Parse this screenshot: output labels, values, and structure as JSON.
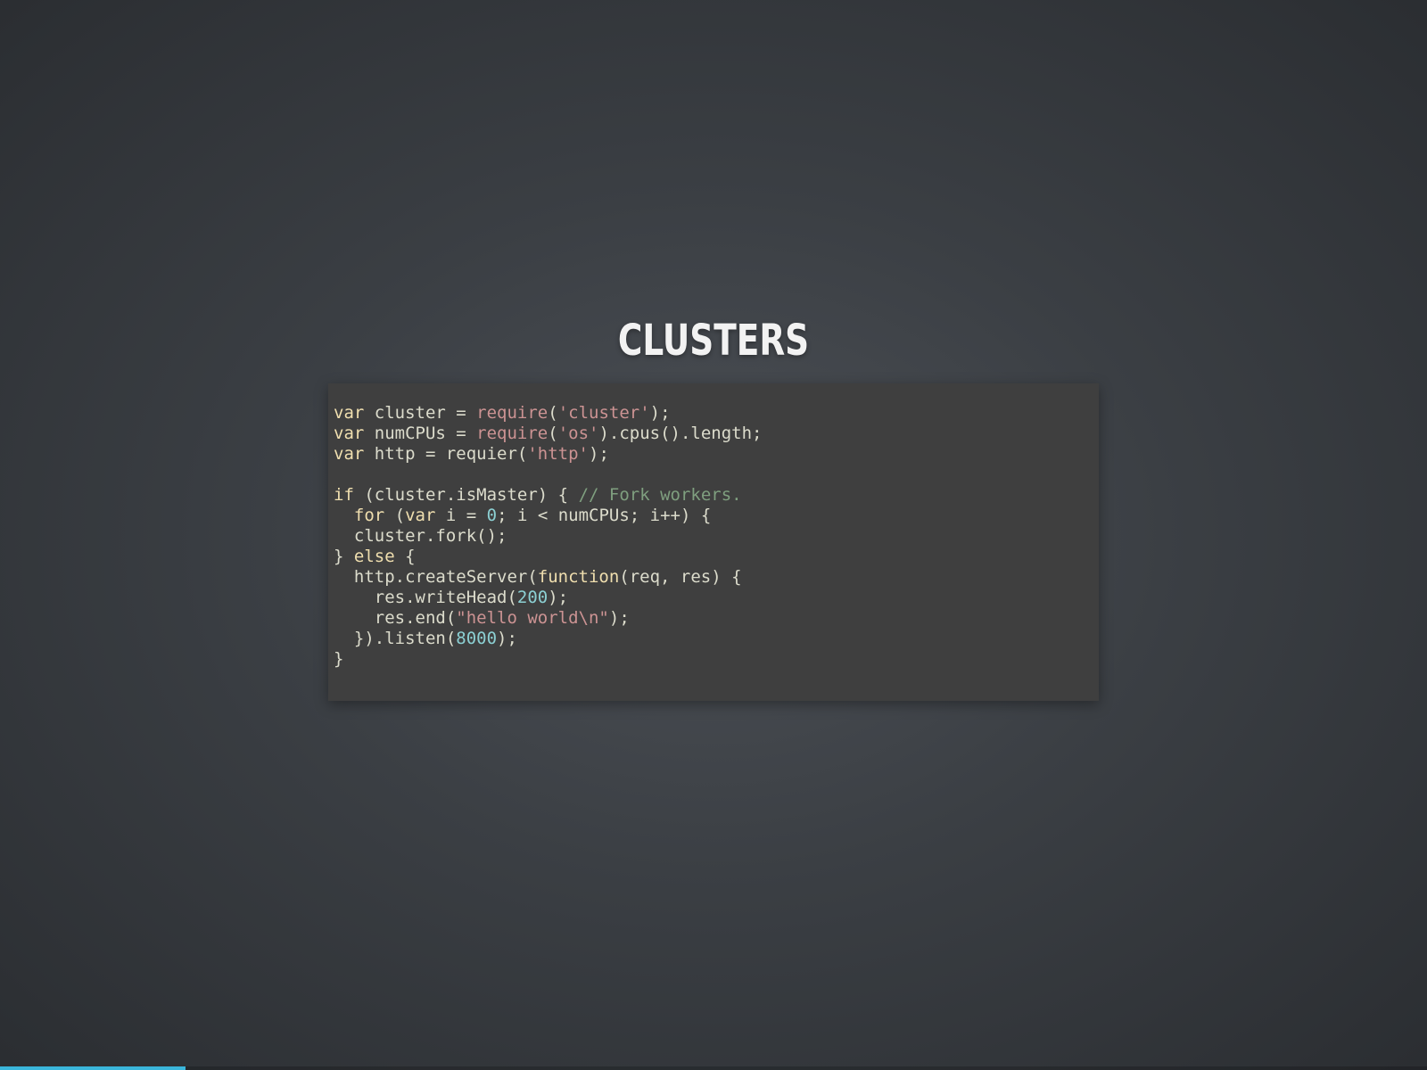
{
  "slide": {
    "title": "CLUSTERS"
  },
  "code": {
    "language": "javascript",
    "lines": [
      [
        {
          "t": "kw",
          "v": "var"
        },
        {
          "t": "pl",
          "v": " cluster = "
        },
        {
          "t": "fn",
          "v": "require"
        },
        {
          "t": "pl",
          "v": "("
        },
        {
          "t": "str",
          "v": "'cluster'"
        },
        {
          "t": "pl",
          "v": ");"
        }
      ],
      [
        {
          "t": "kw",
          "v": "var"
        },
        {
          "t": "pl",
          "v": " numCPUs = "
        },
        {
          "t": "fn",
          "v": "require"
        },
        {
          "t": "pl",
          "v": "("
        },
        {
          "t": "str",
          "v": "'os'"
        },
        {
          "t": "pl",
          "v": ").cpus().length;"
        }
      ],
      [
        {
          "t": "kw",
          "v": "var"
        },
        {
          "t": "pl",
          "v": " http = requier("
        },
        {
          "t": "str",
          "v": "'http'"
        },
        {
          "t": "pl",
          "v": ");"
        }
      ],
      [],
      [
        {
          "t": "kw",
          "v": "if"
        },
        {
          "t": "pl",
          "v": " (cluster.isMaster) { "
        },
        {
          "t": "cm",
          "v": "// Fork workers."
        }
      ],
      [
        {
          "t": "pl",
          "v": "  "
        },
        {
          "t": "kw",
          "v": "for"
        },
        {
          "t": "pl",
          "v": " ("
        },
        {
          "t": "kw",
          "v": "var"
        },
        {
          "t": "pl",
          "v": " i = "
        },
        {
          "t": "num",
          "v": "0"
        },
        {
          "t": "pl",
          "v": "; i < numCPUs; i++) {"
        }
      ],
      [
        {
          "t": "pl",
          "v": "  cluster.fork();"
        }
      ],
      [
        {
          "t": "pl",
          "v": "} "
        },
        {
          "t": "kw",
          "v": "else"
        },
        {
          "t": "pl",
          "v": " {"
        }
      ],
      [
        {
          "t": "pl",
          "v": "  http.createServer("
        },
        {
          "t": "kw",
          "v": "function"
        },
        {
          "t": "pl",
          "v": "(req, res) {"
        }
      ],
      [
        {
          "t": "pl",
          "v": "    res.writeHead("
        },
        {
          "t": "num",
          "v": "200"
        },
        {
          "t": "pl",
          "v": ");"
        }
      ],
      [
        {
          "t": "pl",
          "v": "    res.end("
        },
        {
          "t": "str",
          "v": "\"hello world\\n\""
        },
        {
          "t": "pl",
          "v": ");"
        }
      ],
      [
        {
          "t": "pl",
          "v": "  }).listen("
        },
        {
          "t": "num",
          "v": "8000"
        },
        {
          "t": "pl",
          "v": ");"
        }
      ],
      [
        {
          "t": "pl",
          "v": "}"
        }
      ]
    ]
  },
  "progress": {
    "fraction": 0.13,
    "color": "#3ab6db"
  },
  "colors": {
    "title": "#f2f2f2",
    "code_background": "#3f3f3f",
    "keyword": "#f0dfaf",
    "string": "#cc9393",
    "number": "#8cd0d3",
    "comment": "#7f9f7f",
    "plain": "#dcdccc"
  }
}
